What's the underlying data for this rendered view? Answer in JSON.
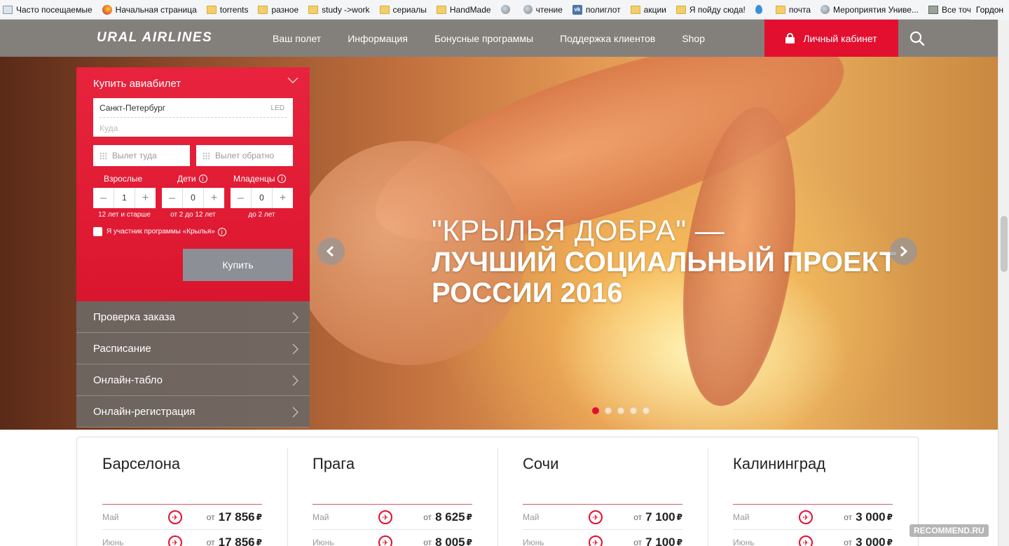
{
  "bookmarks": {
    "items": [
      {
        "label": "Часто посещаемые",
        "icon": "page-icon"
      },
      {
        "label": "Начальная страница",
        "icon": "firefox-icon"
      },
      {
        "label": "torrents",
        "icon": "folder-icon"
      },
      {
        "label": "разное",
        "icon": "folder-icon"
      },
      {
        "label": "study ->work",
        "icon": "folder-icon"
      },
      {
        "label": "сериалы",
        "icon": "folder-icon"
      },
      {
        "label": "HandMade",
        "icon": "folder-icon"
      },
      {
        "label": "",
        "icon": "globe-icon"
      },
      {
        "label": "чтение",
        "icon": "globe-icon"
      },
      {
        "label": "полиглот",
        "icon": "vk-icon"
      },
      {
        "label": "акции",
        "icon": "folder-icon"
      },
      {
        "label": "Я пойду сюда!",
        "icon": "folder-icon"
      },
      {
        "label": "",
        "icon": "drop-icon"
      },
      {
        "label": "почта",
        "icon": "folder-icon"
      },
      {
        "label": "Мероприятия Униве...",
        "icon": "globe-icon"
      },
      {
        "label": "Все точки буккросси...",
        "icon": "image-icon"
      }
    ],
    "trailing": "Гордон"
  },
  "header": {
    "logo": "URAL AIRLINES",
    "nav": [
      "Ваш полет",
      "Информация",
      "Бонусные программы",
      "Поддержка клиентов",
      "Shop"
    ],
    "cabinet": "Личный кабинет",
    "accent": "#e30f2f"
  },
  "booking": {
    "title": "Купить авиабилет",
    "from_value": "Санкт-Петербург",
    "from_code": "LED",
    "to_placeholder": "Куда",
    "date_out_placeholder": "Вылет туда",
    "date_back_placeholder": "Вылет обратно",
    "adults": {
      "label": "Взрослые",
      "value": "1",
      "hint": "12 лет и старше"
    },
    "children": {
      "label": "Дети",
      "value": "0",
      "hint": "от 2 до 12 лет"
    },
    "infants": {
      "label": "Младенцы",
      "value": "0",
      "hint": "до 2 лет"
    },
    "minus": "–",
    "plus": "+",
    "wings_checkbox": "Я участник программы «Крылья»",
    "buy_button": "Купить"
  },
  "side_menu": [
    "Проверка заказа",
    "Расписание",
    "Онлайн-табло",
    "Онлайн-регистрация"
  ],
  "hero": {
    "line1": "\"КРЫЛЬЯ ДОБРА\" —",
    "line2": "ЛУЧШИЙ СОЦИАЛЬНЫЙ ПРОЕКТ",
    "line3": "РОССИИ 2016",
    "slides_total": 5,
    "active_slide": 1
  },
  "destinations": [
    {
      "city": "Барселона",
      "rows": [
        {
          "month": "Май",
          "from": "от",
          "price": "17 856",
          "currency": "₽"
        },
        {
          "month": "Июнь",
          "from": "от",
          "price": "17 856",
          "currency": "₽"
        }
      ]
    },
    {
      "city": "Прага",
      "rows": [
        {
          "month": "Май",
          "from": "от",
          "price": "8 625",
          "currency": "₽"
        },
        {
          "month": "Июнь",
          "from": "от",
          "price": "8 005",
          "currency": "₽"
        }
      ]
    },
    {
      "city": "Сочи",
      "rows": [
        {
          "month": "Май",
          "from": "от",
          "price": "7 100",
          "currency": "₽"
        },
        {
          "month": "Июнь",
          "from": "от",
          "price": "7 100",
          "currency": "₽"
        }
      ]
    },
    {
      "city": "Калининград",
      "rows": [
        {
          "month": "Май",
          "from": "от",
          "price": "3 000",
          "currency": "₽"
        },
        {
          "month": "Июнь",
          "from": "от",
          "price": "3 000",
          "currency": "₽"
        }
      ]
    }
  ],
  "watermark": "RECOMMEND.RU"
}
